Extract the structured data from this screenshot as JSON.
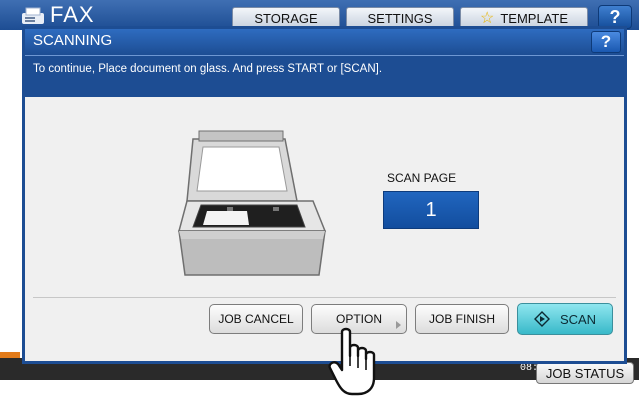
{
  "app": {
    "title": "FAX",
    "tabs": [
      {
        "label": "STORAGE"
      },
      {
        "label": "SETTINGS"
      },
      {
        "label": "TEMPLATE"
      }
    ],
    "help_label": "?"
  },
  "dialog": {
    "title": "SCANNING",
    "help_label": "?",
    "message": "To continue, Place document on glass. And press START or [SCAN].",
    "scan_page_label": "SCAN PAGE",
    "scan_page_value": "1",
    "buttons": {
      "job_cancel": "JOB CANCEL",
      "option": "OPTION",
      "job_finish": "JOB FINISH",
      "scan": "SCAN"
    }
  },
  "footer": {
    "clock_time": "08:51",
    "job_status": "JOB STATUS"
  },
  "colors": {
    "brand_blue": "#1d4d93",
    "scan_button": "#38b9c9",
    "accent_orange": "#e27b1a"
  }
}
